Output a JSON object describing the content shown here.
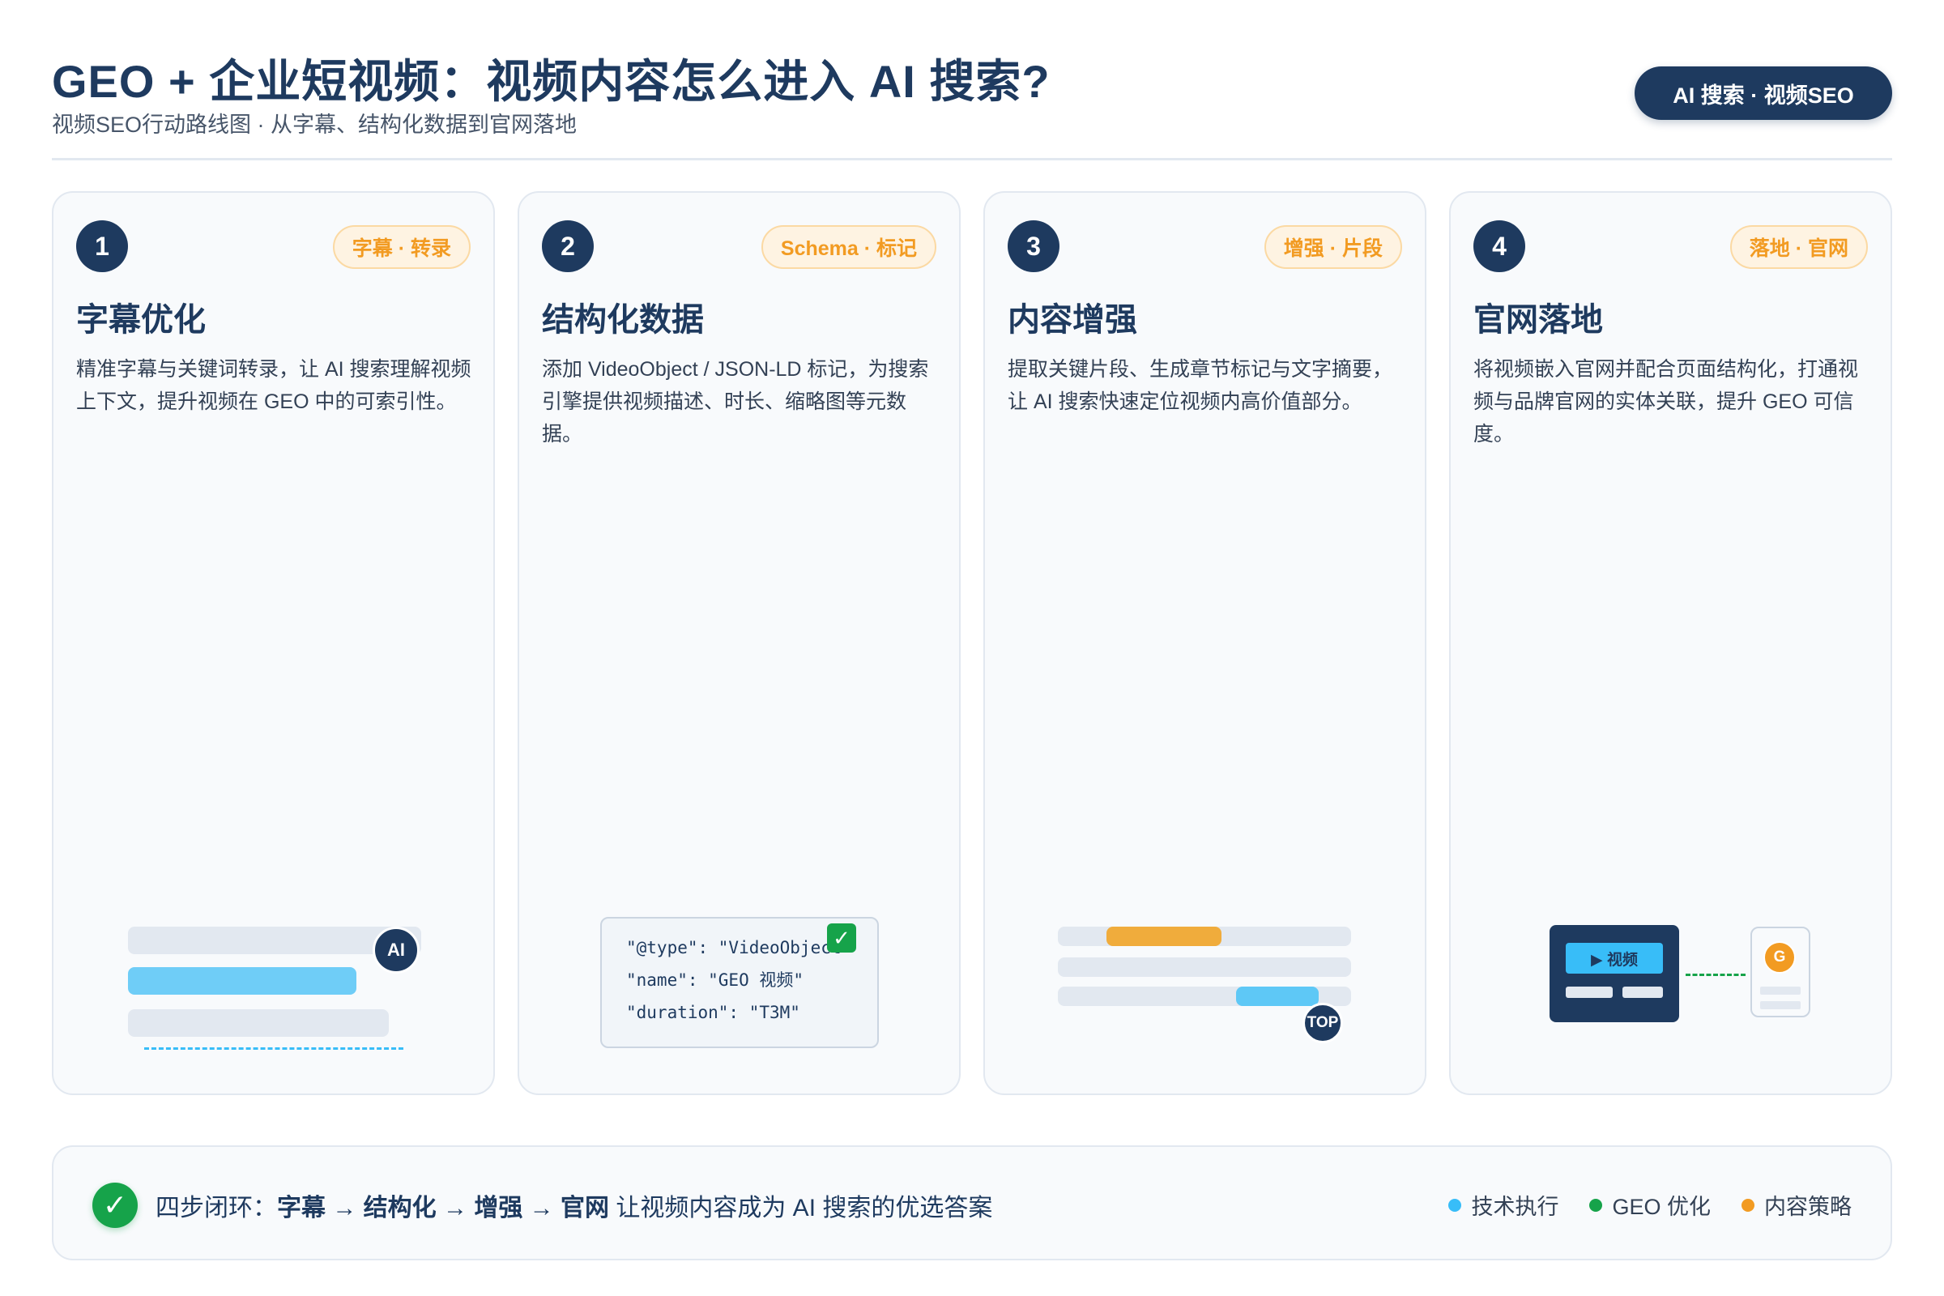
{
  "header": {
    "title": "GEO + 企业短视频：视频内容怎么进入 AI 搜索?",
    "subtitle": "视频SEO行动路线图 · 从字幕、结构化数据到官网落地",
    "badge": "AI 搜索 · 视频SEO"
  },
  "cards": [
    {
      "number": "1",
      "tag": "字幕 · 转录",
      "title": "字幕优化",
      "description": "精准字幕与关键词转录，让 AI 搜索理解视频上下文，提升视频在 GEO 中的可索引性。",
      "illustration": {
        "badge": "AI"
      }
    },
    {
      "number": "2",
      "tag": "Schema · 标记",
      "title": "结构化数据",
      "description": "添加 VideoObject / JSON-LD 标记，为搜索引擎提供视频描述、时长、缩略图等元数据。",
      "illustration": {
        "code_lines": [
          "\"@type\": \"VideoObject\"",
          "\"name\": \"GEO 视频\"",
          "\"duration\": \"T3M\""
        ],
        "check": "✓"
      }
    },
    {
      "number": "3",
      "tag": "增强 · 片段",
      "title": "内容增强",
      "description": "提取关键片段、生成章节标记与文字摘要，让 AI 搜索快速定位视频内高价值部分。",
      "illustration": {
        "badge": "TOP"
      }
    },
    {
      "number": "4",
      "tag": "落地 · 官网",
      "title": "官网落地",
      "description": "将视频嵌入官网并配合页面结构化，打通视频与品牌官网的实体关联，提升 GEO 可信度。",
      "illustration": {
        "video_label": "▶ 视频",
        "site_badge": "G"
      }
    }
  ],
  "footer": {
    "check": "✓",
    "prefix": "四步闭环：",
    "flow": "字幕 → 结构化 → 增强 → 官网",
    "suffix": " 让视频内容成为 AI 搜索的优选答案",
    "legend": [
      {
        "label": "技术执行",
        "color": "#38bdf8"
      },
      {
        "label": "GEO 优化",
        "color": "#16a34a"
      },
      {
        "label": "内容策略",
        "color": "#f29b22"
      }
    ]
  },
  "colors": {
    "navy": "#1e3a5f",
    "orange": "#f29b22",
    "sky": "#5ec8f6",
    "green": "#16a34a",
    "light_bar": "#e2e8f0"
  }
}
